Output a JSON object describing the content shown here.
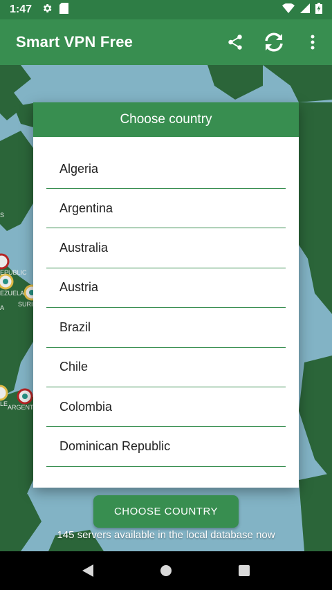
{
  "status_bar": {
    "time": "1:47",
    "icons_left": [
      "gear-icon",
      "sd-card-icon"
    ],
    "icons_right": [
      "wifi-icon",
      "signal-icon",
      "battery-icon"
    ]
  },
  "app_bar": {
    "title": "Smart VPN Free",
    "actions": [
      "share-icon",
      "refresh-icon",
      "more-vert-icon"
    ]
  },
  "map": {
    "labels": [
      "EPUBLIC",
      "EZUELA",
      "SURI",
      "LE",
      "ARGENT",
      "S",
      "A"
    ]
  },
  "dialog": {
    "title": "Choose country",
    "countries": [
      "Algeria",
      "Argentina",
      "Australia",
      "Austria",
      "Brazil",
      "Chile",
      "Colombia",
      "Dominican Republic"
    ]
  },
  "button": {
    "label": "CHOOSE COUNTRY"
  },
  "footer": {
    "servers_note": "145 servers available in the local database now"
  },
  "nav": {
    "buttons": [
      "back-icon",
      "home-icon",
      "recents-icon"
    ]
  },
  "colors": {
    "primary": "#388e50",
    "primary_dark": "#2e7d45",
    "ocean": "#8ec3d6",
    "land": "#2f6e3e"
  }
}
